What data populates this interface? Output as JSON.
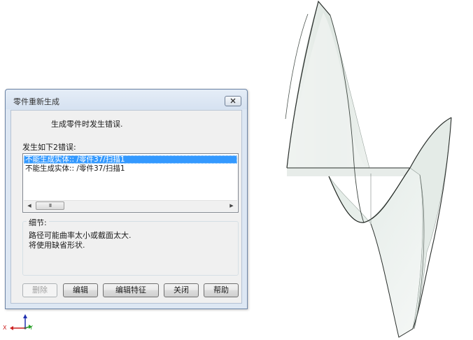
{
  "dialog": {
    "title": "零件重新生成",
    "close_label": "☐",
    "message": "生成零件时发生错误.",
    "errors_label": "发生如下2错误:",
    "errors": [
      {
        "text": "不能生成实体:: /零件37/扫描1",
        "selected": true
      },
      {
        "text": "不能生成实体:: /零件37/扫描1",
        "selected": false
      }
    ],
    "scrollbar": {
      "left_arrow": "◀",
      "right_arrow": "▶",
      "thumb_grip": "III"
    },
    "details": {
      "label": "细节:",
      "lines": [
        "路径可能曲率太小或截面太大.",
        "将使用缺省形状."
      ]
    },
    "buttons": {
      "delete": "删除",
      "edit": "编辑",
      "edit_feature": "编辑特征",
      "close": "关闭",
      "help": "帮助"
    }
  },
  "triad": {
    "x_label": "X",
    "y_label": "Y",
    "x_color": "#cc2020",
    "y_color": "#2aa02a",
    "z_color": "#2030b0"
  },
  "colors": {
    "dialog_frame": "#dde7f3",
    "selection": "#3399ff",
    "surface_fill": "#e8eeea"
  }
}
